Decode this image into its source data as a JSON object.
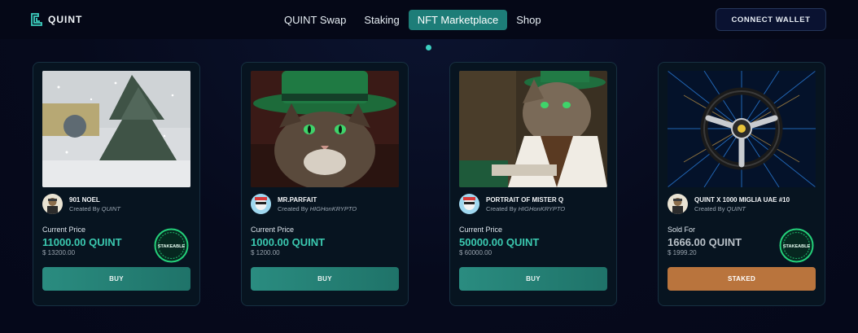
{
  "brand": {
    "name": "QUINT"
  },
  "nav": {
    "items": [
      {
        "label": "QUINT Swap",
        "active": false
      },
      {
        "label": "Staking",
        "active": false
      },
      {
        "label": "NFT Marketplace",
        "active": true
      },
      {
        "label": "Shop",
        "active": false
      }
    ],
    "connect_label": "CONNECT WALLET"
  },
  "colors": {
    "accent": "#1d7d78",
    "price": "#3bc9b0",
    "buy_button": "#2a8c80",
    "staked_button": "#b9743d",
    "background": "#070b1e"
  },
  "cards": [
    {
      "name": "901 NOEL",
      "created_prefix": "Created By",
      "creator": "QUINT",
      "price_label": "Current Price",
      "price": "11000.00 QUINT",
      "usd": "$ 13200.00",
      "badge": "STAKEABLE",
      "action": "BUY"
    },
    {
      "name": "MR.PARFAIT",
      "created_prefix": "Created By",
      "creator": "HIGHonKRYPTO",
      "price_label": "Current Price",
      "price": "1000.00 QUINT",
      "usd": "$ 1200.00",
      "action": "BUY"
    },
    {
      "name": "PORTRAIT OF MISTER Q",
      "created_prefix": "Created By",
      "creator": "HIGHonKRYPTO",
      "price_label": "Current Price",
      "price": "50000.00 QUINT",
      "usd": "$ 60000.00",
      "action": "BUY"
    },
    {
      "name": "QUINT X 1000 MIGLIA UAE #10",
      "created_prefix": "Created By",
      "creator": "QUINT",
      "price_label": "Sold For",
      "price": "1666.00 QUINT",
      "usd": "$ 1999.20",
      "badge": "STAKEABLE",
      "action": "STAKED"
    }
  ]
}
